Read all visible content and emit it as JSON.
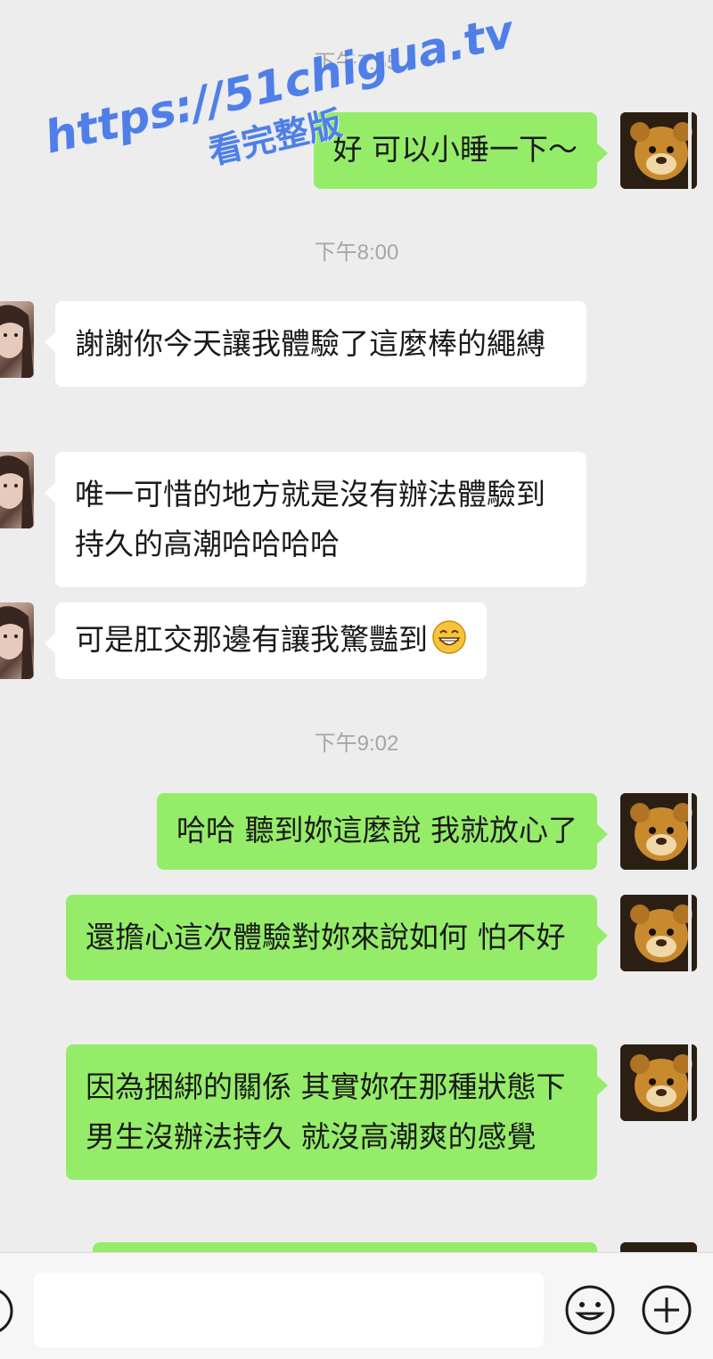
{
  "watermark": {
    "line1": "https://51chigua.tv",
    "line2": "看完整版"
  },
  "messages": [
    {
      "type": "time",
      "text": "下午7:55"
    },
    {
      "type": "out",
      "text": "好 可以小睡一下～"
    },
    {
      "type": "time",
      "text": "下午8:00"
    },
    {
      "type": "in",
      "text": "謝謝你今天讓我體驗了這麼棒的繩縛"
    },
    {
      "type": "in",
      "text": "唯一可惜的地方就是沒有辦法體驗到持久的高潮哈哈哈哈"
    },
    {
      "type": "in",
      "text": "可是肛交那邊有讓我驚豔到",
      "emoji": "grin-emoji"
    },
    {
      "type": "time",
      "text": "下午9:02"
    },
    {
      "type": "out",
      "text": "哈哈 聽到妳這麼說 我就放心了"
    },
    {
      "type": "out",
      "text": "還擔心這次體驗對妳來說如何 怕不好"
    },
    {
      "type": "out",
      "text": "因為捆綁的關係 其實妳在那種狀態下 男生沒辦法持久 就沒高潮爽的感覺"
    }
  ],
  "bottom_bar": {
    "input_value": "",
    "icons": [
      "voice-icon",
      "emoji-icon",
      "plus-icon"
    ]
  },
  "colors": {
    "background": "#ededed",
    "outgoing_bubble": "#95ec69",
    "incoming_bubble": "#ffffff",
    "timestamp": "#a6a6a6",
    "watermark": "#4f7fe6"
  }
}
